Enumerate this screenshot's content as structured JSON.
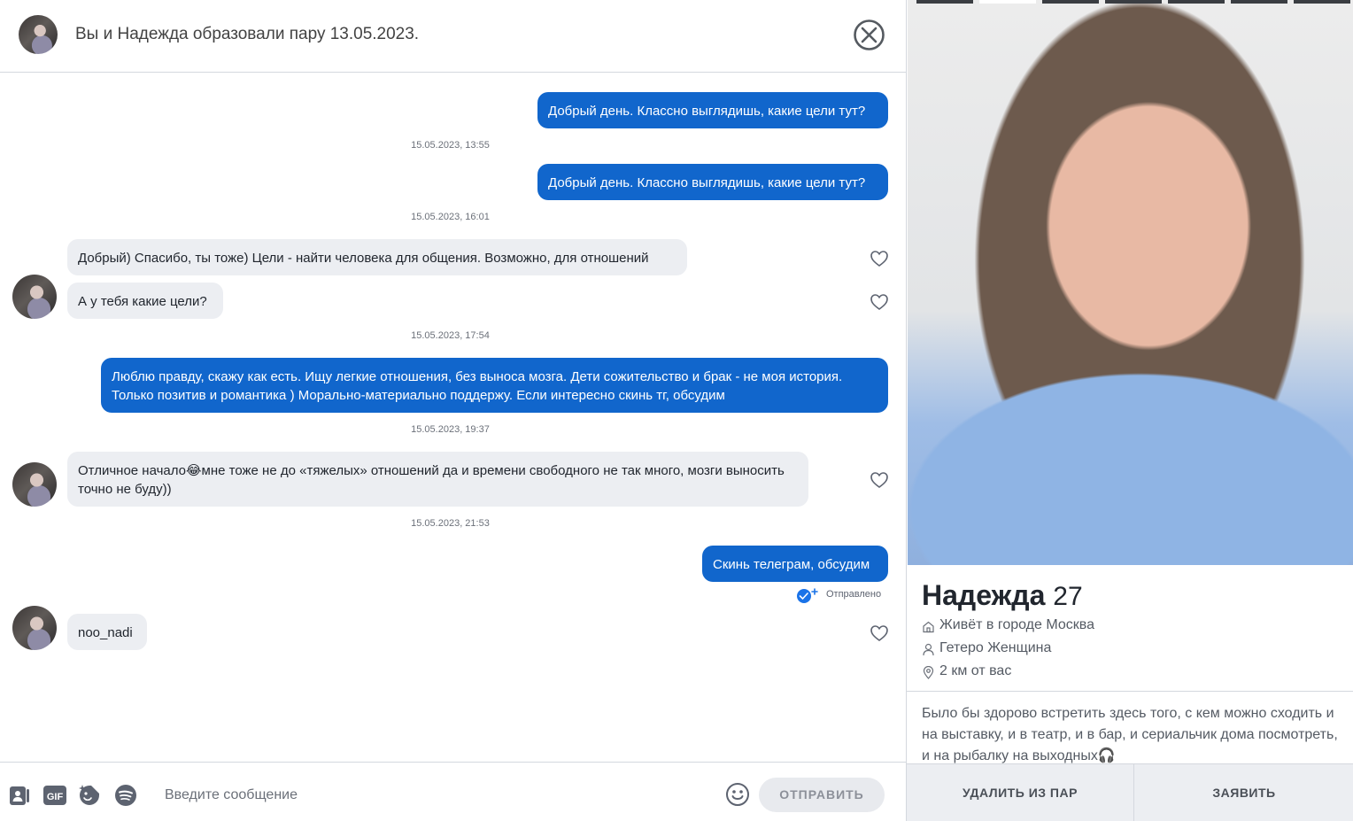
{
  "header": {
    "title": "Вы и Надежда образовали пару 13.05.2023.",
    "avatar_icon": "match-avatar",
    "close_icon": "close-circle-icon"
  },
  "messages": [
    {
      "text": "Добрый день. Классно выглядишь, какие цели тут?",
      "direction": "out"
    },
    {
      "timestamp": "15.05.2023, 13:55"
    },
    {
      "text": "Добрый день. Классно выглядишь, какие цели тут?",
      "direction": "out"
    },
    {
      "timestamp": "15.05.2023, 16:01"
    },
    {
      "text": "Добрый) Спасибо, ты тоже) Цели - найти человека для общения. Возможно, для отношений",
      "direction": "in"
    },
    {
      "text": "А у тебя какие цели?",
      "direction": "in"
    },
    {
      "timestamp": "15.05.2023, 17:54"
    },
    {
      "text": "Люблю правду, скажу как есть. Ищу легкие отношения, без выноса мозга. Дети сожительство и брак - не моя история. Только позитив и романтика ) Морально-материально поддержу. Если интересно скинь тг, обсудим",
      "direction": "out"
    },
    {
      "timestamp": "15.05.2023, 19:37"
    },
    {
      "text": "Отличное начало😂мне тоже не до «тяжелых» отношений да и времени свободного не так много, мозги выносить точно не буду))",
      "direction": "in"
    },
    {
      "timestamp": "15.05.2023, 21:53"
    },
    {
      "text": "Скинь телеграм, обсудим",
      "direction": "out",
      "status": "Отправлено"
    },
    {
      "text": "noo_nadi",
      "direction": "in"
    }
  ],
  "composer": {
    "placeholder": "Введите сообщение",
    "send_label": "ОТПРАВИТЬ",
    "tools": [
      "contact-card-icon",
      "gif-icon",
      "sticker-icon",
      "spotify-icon",
      "emoji-icon"
    ]
  },
  "profile": {
    "name": "Надежда",
    "age": "27",
    "lives": "Живёт в городе Москва",
    "orientation": "Гетеро Женщина",
    "distance": "2 км от вас",
    "bio": "Было бы здорово встретить здесь того, с кем можно сходить и на выставку, и в театр, и в бар, и сериальчик дома посмотреть, и на рыбалку на выходных🎧",
    "photo_count": 7,
    "active_photo": 1,
    "unmatch_label": "УДАЛИТЬ ИЗ ПАР",
    "report_label": "ЗАЯВИТЬ"
  },
  "colors": {
    "outgoing_bubble": "#1166cc",
    "incoming_bubble": "#eceef2",
    "read_check": "#1a73e8"
  }
}
